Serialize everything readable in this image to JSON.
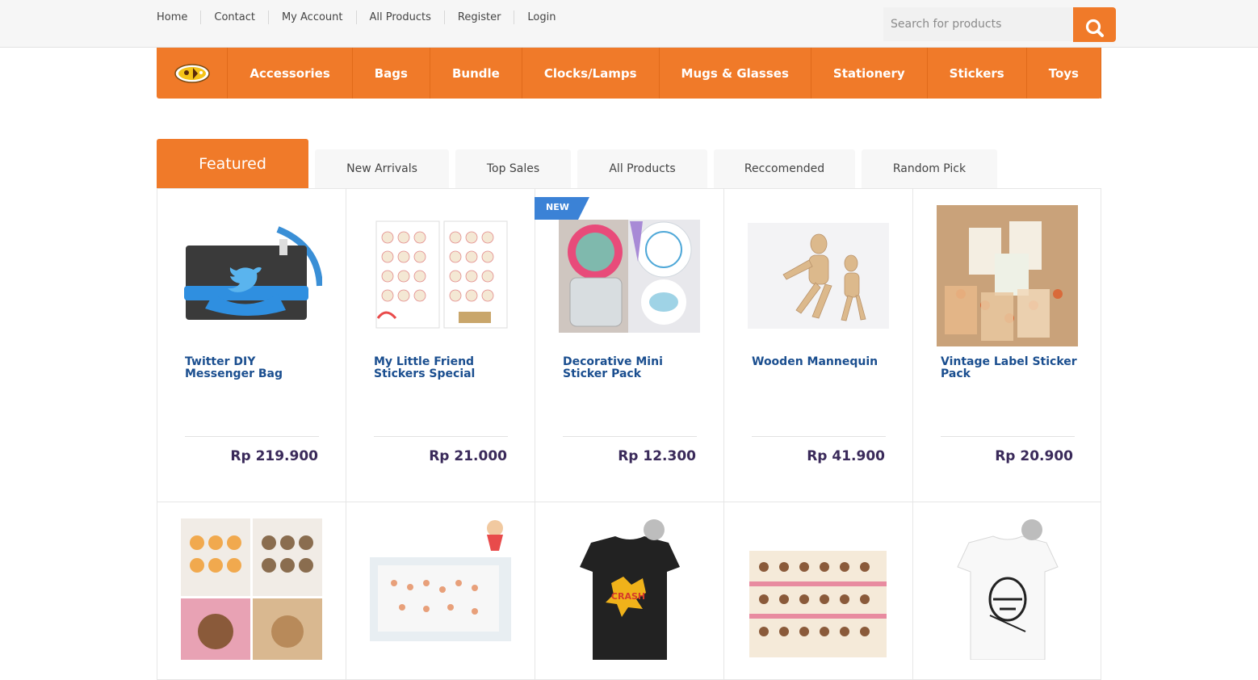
{
  "top_links": [
    "Home",
    "Contact",
    "My Account",
    "All Products",
    "Register",
    "Login"
  ],
  "search": {
    "placeholder": "Search for products",
    "icon": "search-icon"
  },
  "nav": {
    "logo": "logo",
    "items": [
      "Accessories",
      "Bags",
      "Bundle",
      "Clocks/Lamps",
      "Mugs & Glasses",
      "Stationery",
      "Stickers",
      "Toys"
    ]
  },
  "tabs": [
    "Featured",
    "New Arrivals",
    "Top Sales",
    "All Products",
    "Reccomended",
    "Random Pick"
  ],
  "active_tab": "Featured",
  "badge": "NEW",
  "colors": {
    "accent": "#f07a29",
    "link": "#1a4e8f",
    "price": "#3a2a5a",
    "badge": "#3b82d6"
  },
  "products": [
    {
      "name": "Twitter DIY Messenger Bag",
      "price": "Rp 219.900"
    },
    {
      "name": "My Little Friend Stickers Special",
      "price": "Rp 21.000"
    },
    {
      "name": "Decorative Mini Sticker Pack",
      "price": "Rp 12.300",
      "badge": "NEW"
    },
    {
      "name": "Wooden Mannequin",
      "price": "Rp 41.900"
    },
    {
      "name": "Vintage Label Sticker Pack",
      "price": "Rp 20.900"
    }
  ]
}
